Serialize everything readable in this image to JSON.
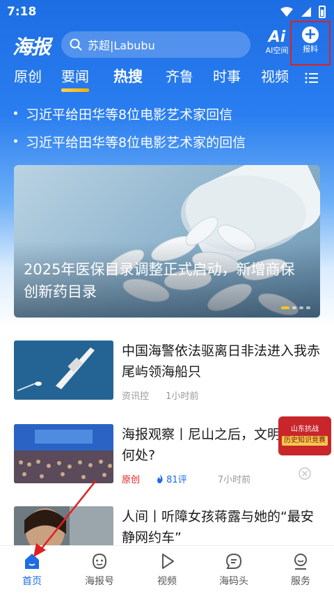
{
  "status_bar": {
    "time": "7:18"
  },
  "header": {
    "logo": "海报",
    "search_text": "苏超|Labubu",
    "ai_label": "AI空间",
    "ai_icon_text": "Ai",
    "report_label": "报料"
  },
  "tabs": [
    {
      "label": "原创"
    },
    {
      "label": "要闻"
    },
    {
      "label": "热搜"
    },
    {
      "label": "齐鲁"
    },
    {
      "label": "时事"
    },
    {
      "label": "视频"
    }
  ],
  "headlines": [
    "习近平给田华等8位电影艺术家回信",
    "习近平给田华等8位电影艺术家的回信"
  ],
  "banner": {
    "title": "2025年医保目录调整正式启动，新增商保创新药目录"
  },
  "news": [
    {
      "title": "中国海警依法驱离日非法进入我赤尾屿领海船只",
      "source": "资讯控",
      "time": "1小时前"
    },
    {
      "title": "海报观察丨尼山之后，文明将走向何处?",
      "source": "原创",
      "comments": "81评",
      "time": "7小时前"
    },
    {
      "title": "人间丨听障女孩蒋露与她的“最安静网约车”"
    }
  ],
  "float_badge": {
    "line1": "山东抗战",
    "line2": "历史知识竞赛"
  },
  "bottom_nav": [
    {
      "label": "首页"
    },
    {
      "label": "海报号"
    },
    {
      "label": "视频"
    },
    {
      "label": "海码头"
    },
    {
      "label": "服务"
    }
  ],
  "colors": {
    "brand_blue": "#1d6de3",
    "highlight_red": "#e02020"
  }
}
